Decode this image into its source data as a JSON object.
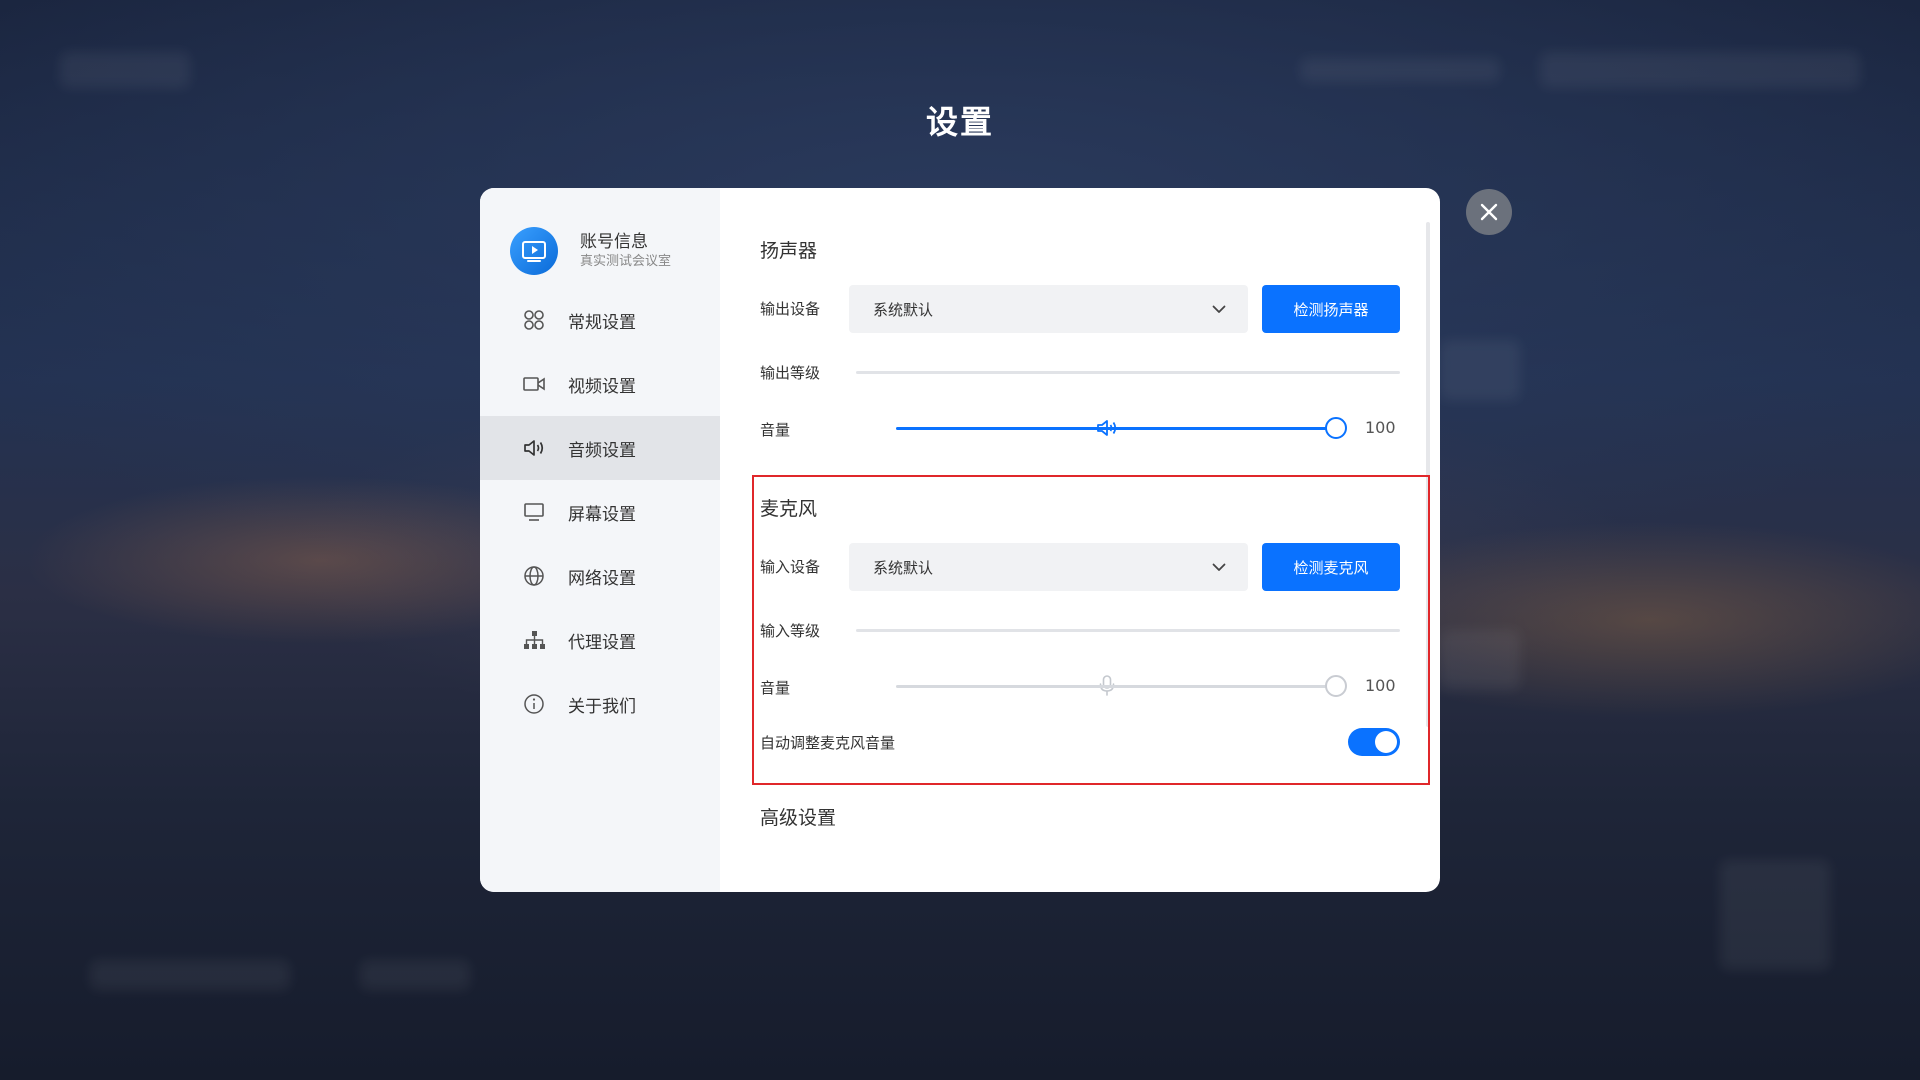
{
  "page_title": "设置",
  "account": {
    "name": "账号信息",
    "subtitle": "真实测试会议室"
  },
  "sidebar": {
    "items": [
      {
        "label": "常规设置",
        "icon": "grid-icon"
      },
      {
        "label": "视频设置",
        "icon": "camera-icon"
      },
      {
        "label": "音频设置",
        "icon": "speaker-icon",
        "active": true
      },
      {
        "label": "屏幕设置",
        "icon": "monitor-icon"
      },
      {
        "label": "网络设置",
        "icon": "globe-icon"
      },
      {
        "label": "代理设置",
        "icon": "network-icon"
      },
      {
        "label": "关于我们",
        "icon": "info-icon"
      }
    ]
  },
  "speaker": {
    "title": "扬声器",
    "output_device_label": "输出设备",
    "output_device_value": "系统默认",
    "test_button": "检测扬声器",
    "output_level_label": "输出等级",
    "volume_label": "音量",
    "volume_value": "100",
    "volume_fraction": 1.0
  },
  "microphone": {
    "title": "麦克风",
    "input_device_label": "输入设备",
    "input_device_value": "系统默认",
    "test_button": "检测麦克风",
    "input_level_label": "输入等级",
    "volume_label": "音量",
    "volume_value": "100",
    "volume_fraction": 1.0,
    "auto_adjust_label": "自动调整麦克风音量",
    "auto_adjust_on": true
  },
  "advanced": {
    "title": "高级设置"
  },
  "colors": {
    "accent": "#0a72ff",
    "highlight": "#e0272a"
  }
}
